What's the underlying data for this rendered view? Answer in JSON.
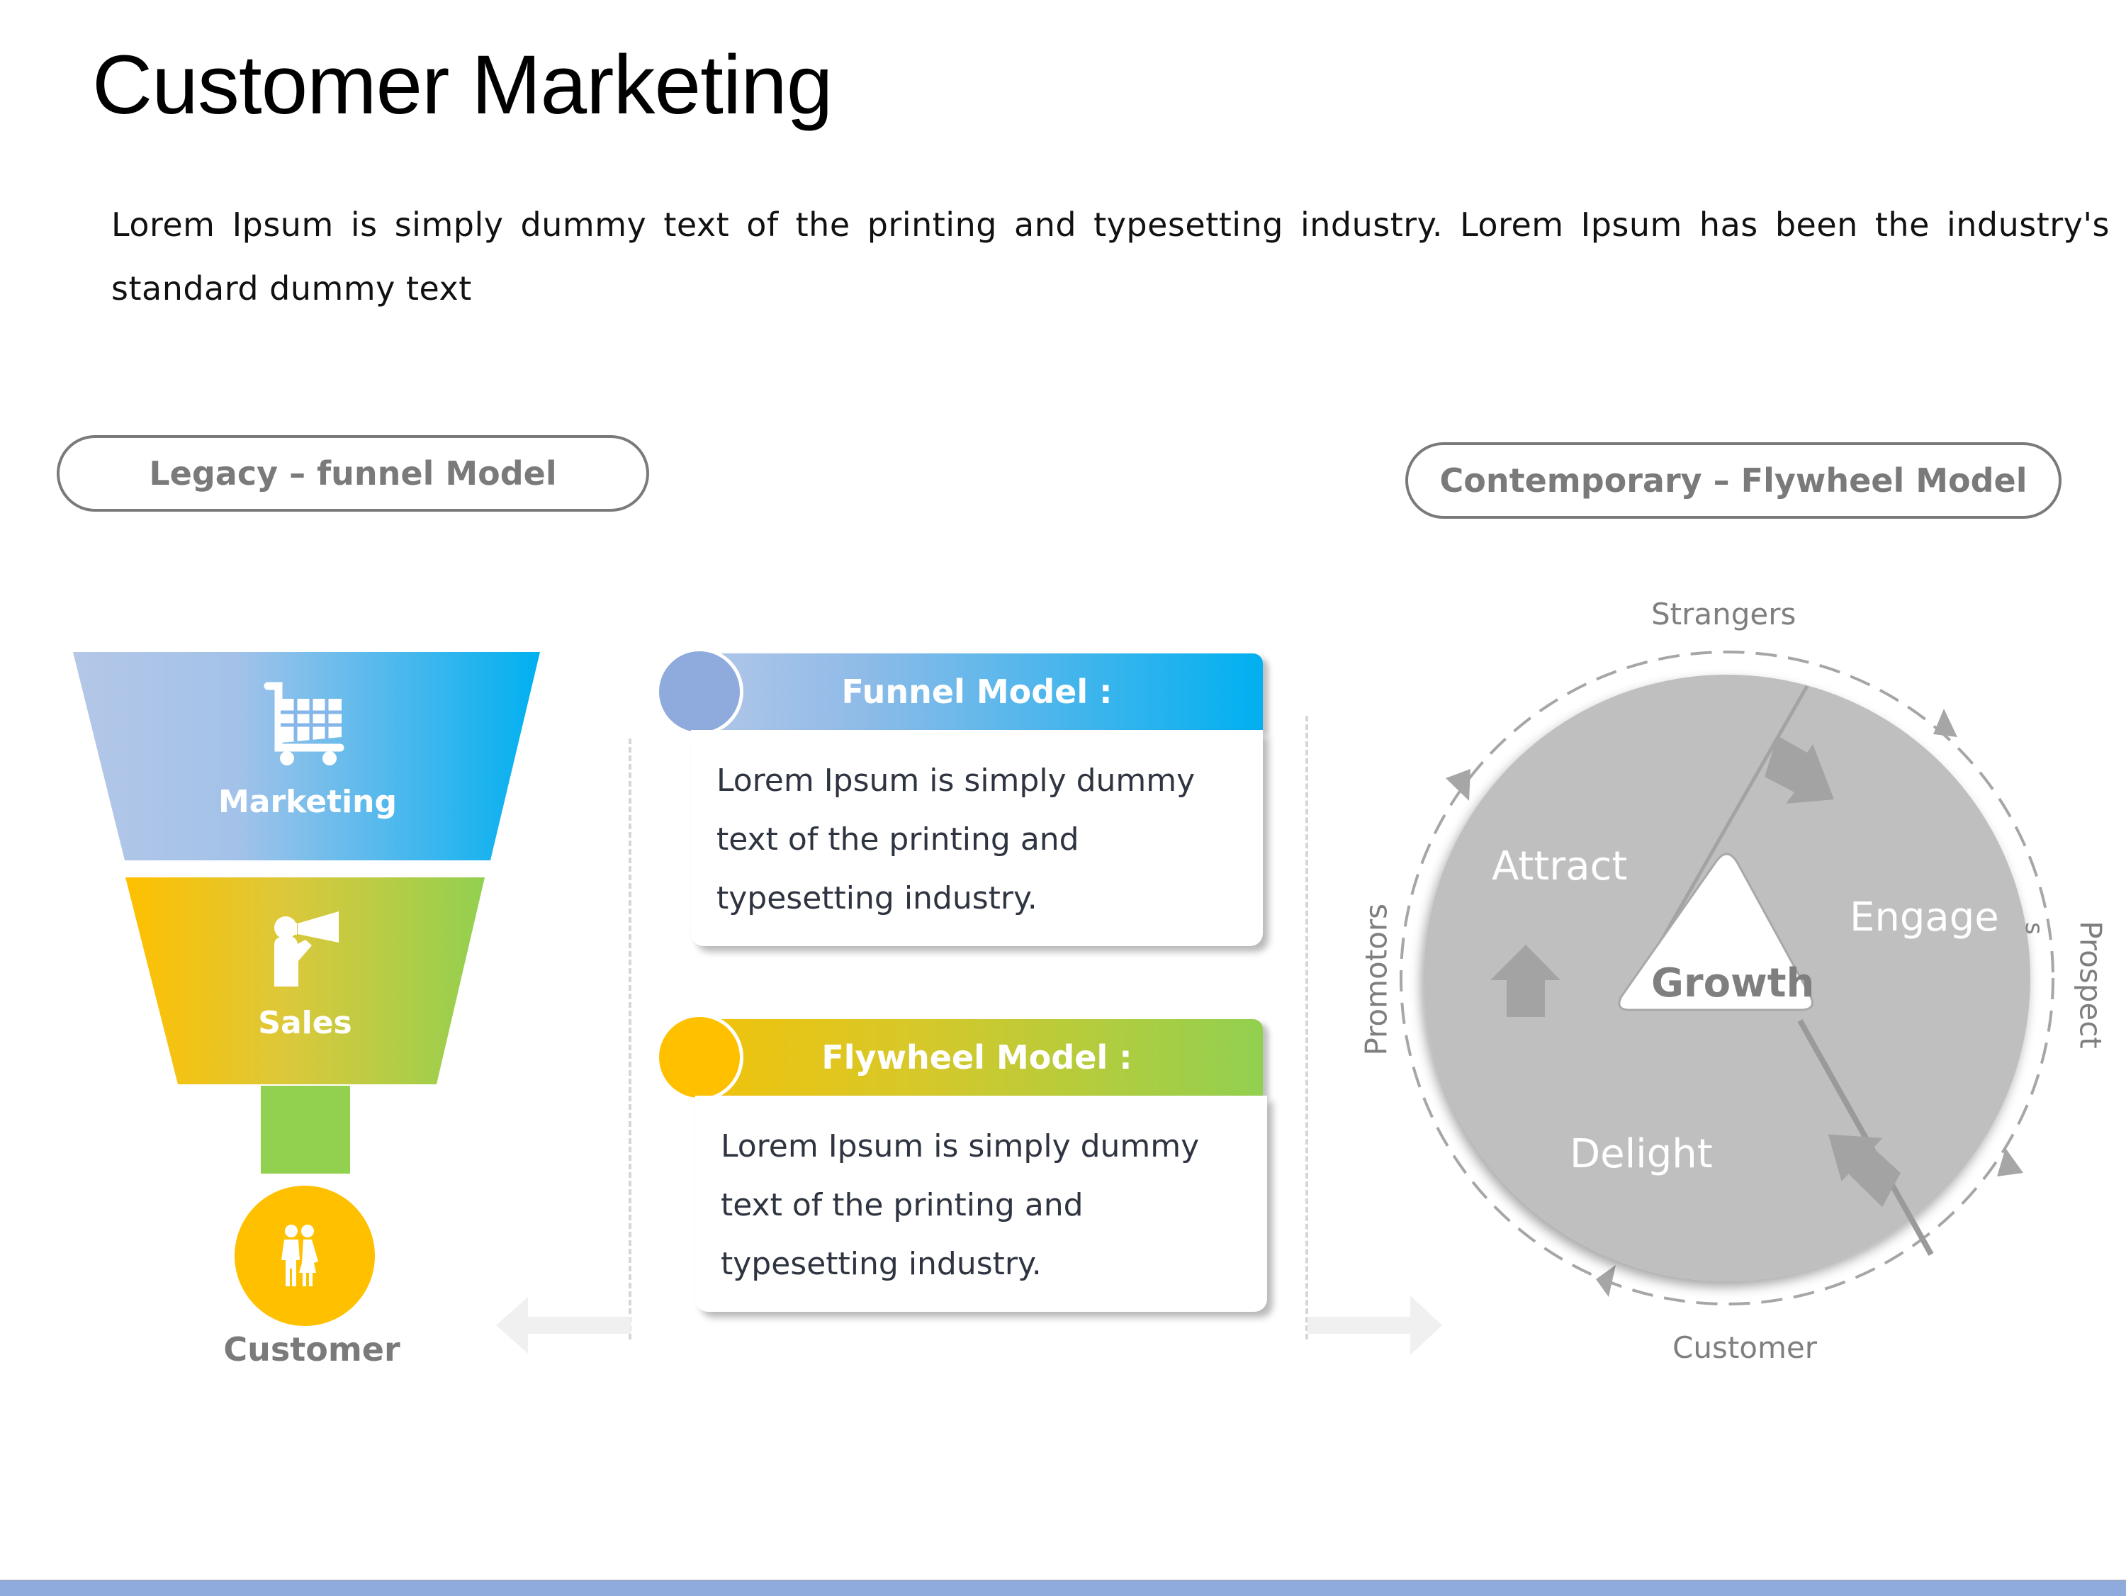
{
  "header": {
    "title": "Customer Marketing",
    "intro": "Lorem Ipsum is simply dummy text of the printing and typesetting industry. Lorem Ipsum has been the industry's standard dummy text"
  },
  "legacy": {
    "pill_label": "Legacy – funnel Model",
    "stages": [
      {
        "label": "Marketing",
        "icon": "shopping-cart-icon"
      },
      {
        "label": "Sales",
        "icon": "megaphone-person-icon"
      }
    ],
    "customer": {
      "label": "Customer",
      "icon": "couple-icon"
    }
  },
  "cards": [
    {
      "title": "Funnel Model :",
      "body": "Lorem Ipsum is simply dummy text of the printing and typesetting industry."
    },
    {
      "title": "Flywheel Model :",
      "body": "Lorem Ipsum is simply dummy text of the printing and typesetting industry."
    }
  ],
  "flywheel": {
    "pill_label": "Contemporary – Flywheel Model",
    "center": "Growth",
    "segments": [
      "Attract",
      "Engage",
      "Delight"
    ],
    "ring_labels": {
      "top": "Strangers",
      "right": "Prospect",
      "right_wrap": "s",
      "bottom": "Customer",
      "left": "Promotors"
    }
  },
  "colors": {
    "marketing_gradient": [
      "#b4c7e7",
      "#00b0f0"
    ],
    "sales_gradient": [
      "#ffc000",
      "#92d050"
    ],
    "stem": "#92d050",
    "customer_circle": "#ffc000",
    "funnel_card_dot": "#8faadc",
    "flywheel_card_dot": "#ffc000",
    "flywheel_fill": "#bfbfbf",
    "accent_bar": "#8faadc",
    "pill_text": "#7a7a7a"
  }
}
